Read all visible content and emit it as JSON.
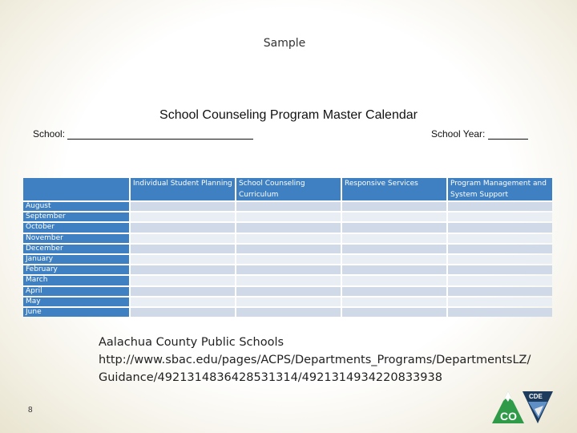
{
  "sample_label": "Sample",
  "title": "School Counseling Program Master Calendar",
  "school_label": "School:",
  "school_year_label": "School Year:",
  "table": {
    "headers": [
      "",
      "Individual Student Planning",
      "School Counseling Curriculum",
      "Responsive Services",
      "Program Management and System Support"
    ],
    "rows": [
      "August",
      "September",
      "October",
      "November",
      "December",
      "January",
      "February",
      "March",
      "April",
      "May",
      "June"
    ]
  },
  "source": {
    "line1": "Aalachua County Public Schools",
    "line2": "http://www.sbac.edu/pages/ACPS/Departments_Programs/DepartmentsLZ/",
    "line3": "Guidance/4921314836428531314/4921314934220833938"
  },
  "page_number": "8",
  "logo": {
    "text_co": "CO",
    "text_cde": "CDE",
    "colors": {
      "green": "#2f9a48",
      "navy": "#1d3b5c"
    }
  },
  "colors": {
    "header_blue": "#3f80c2",
    "row_dark": "#d0d9e7",
    "row_light": "#e9edf4"
  }
}
